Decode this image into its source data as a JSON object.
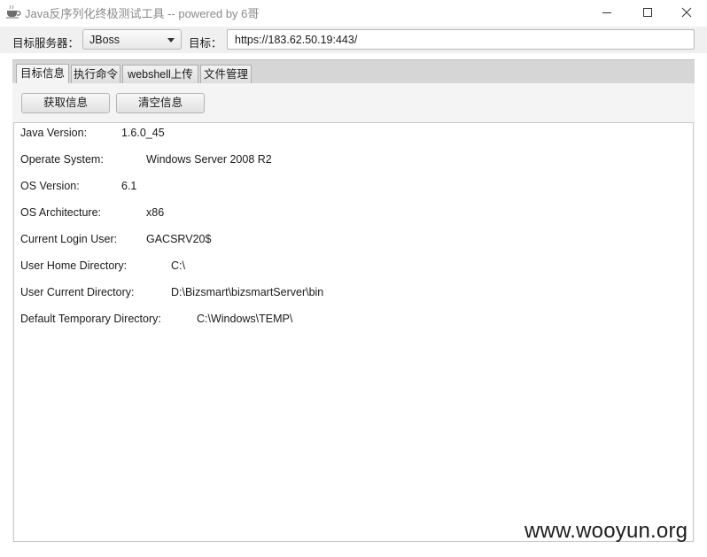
{
  "window": {
    "title": "Java反序列化终极测试工具  -- powered by 6哥",
    "icon": "java-coffee-cup-icon"
  },
  "toolbar": {
    "server_label": "目标服务器：",
    "server_value": "JBoss",
    "target_label": "目标：",
    "target_value": "https://183.62.50.19:443/"
  },
  "tabs": [
    {
      "label": "目标信息",
      "active": true
    },
    {
      "label": "执行命令",
      "active": false
    },
    {
      "label": "webshell上传",
      "active": false
    },
    {
      "label": "文件管理",
      "active": false
    }
  ],
  "actions": {
    "fetch_label": "获取信息",
    "clear_label": "清空信息"
  },
  "info": [
    {
      "key": "Java Version:",
      "value": "1.6.0_45"
    },
    {
      "key": "Operate System:",
      "value": "Windows Server 2008 R2"
    },
    {
      "key": "OS Version:",
      "value": "6.1"
    },
    {
      "key": "OS Architecture:",
      "value": "x86"
    },
    {
      "key": "Current Login User:",
      "value": "GACSRV20$"
    },
    {
      "key": "User Home Directory:",
      "value": "C:\\"
    },
    {
      "key": "User Current Directory:",
      "value": "D:\\Bizsmart\\bizsmartServer\\bin"
    },
    {
      "key": "Default Temporary Directory:",
      "value": "C:\\Windows\\TEMP\\"
    }
  ],
  "watermark": "www.wooyun.org",
  "colors": {
    "toolbar_bg": "#f0f0f0",
    "tabstrip_bg": "#d6d6d6",
    "panel_bg": "#f4f4f4"
  }
}
